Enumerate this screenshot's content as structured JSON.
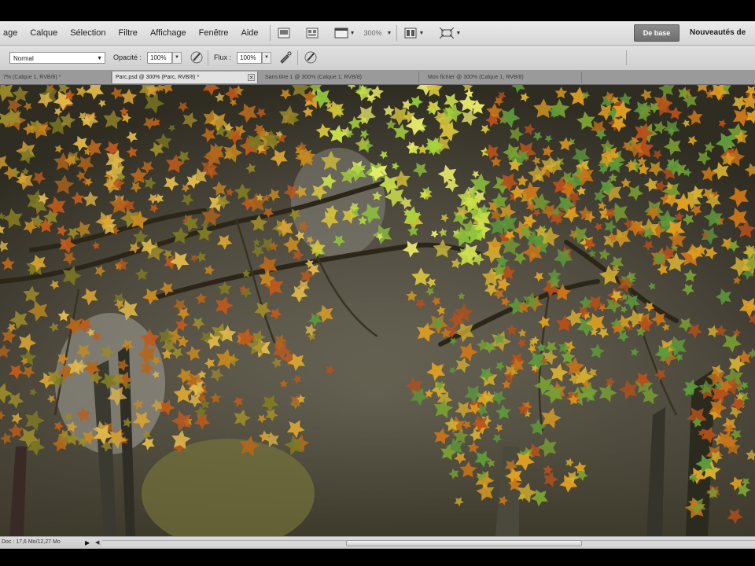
{
  "menubar": {
    "items": [
      "age",
      "Calque",
      "Sélection",
      "Filtre",
      "Affichage",
      "Fenêtre",
      "Aide"
    ],
    "zoom": "300%",
    "workspace_button": "De base",
    "workspace_link": "Nouveautés de"
  },
  "options": {
    "mode_label": "",
    "mode_value": "Normal",
    "opacity_label": "Opacité :",
    "opacity_value": "100%",
    "flow_label": "Flux :",
    "flow_value": "100%"
  },
  "tabs": [
    {
      "label": "7% (Calque 1, RVB/8) *"
    },
    {
      "label": "Parc.psd @ 300% (Parc, RVB/8) *"
    },
    {
      "label": "Sans titre 1 @ 300% (Calque 1, RVB/8)"
    },
    {
      "label": "Mon fichier @ 300% (Calque 1, RVB/8)"
    }
  ],
  "status": {
    "doc_info": "Doc : 17,6 Mo/12,27 Mo"
  },
  "colors": {
    "menubar": "#dedede",
    "workspace_button": "#7c7c7c",
    "tab_active": "#e2e2e2",
    "tab_inactive": "#9a9a9a"
  },
  "icons": [
    "screen-mode-icon",
    "arrange-icon",
    "hand-icon",
    "arrange-documents-icon",
    "extras-icon",
    "airbrush-icon",
    "tablet-pressure-icon"
  ]
}
